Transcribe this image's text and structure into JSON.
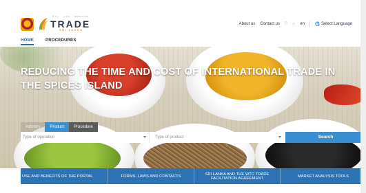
{
  "header": {
    "logo_top": "සිංහල · தமிழ் · ENGLISH",
    "logo_text": "TRADE",
    "logo_sub": "SRI LANKA",
    "links": [
      {
        "label": "About us"
      },
      {
        "label": "Contact us"
      }
    ],
    "languages": [
      "සි",
      "த",
      "en"
    ],
    "translate_label": "Select Language"
  },
  "nav": {
    "items": [
      {
        "label": "HOME"
      },
      {
        "label": "PROCEDURES"
      }
    ]
  },
  "hero": {
    "title": "REDUCING THE TIME AND COST OF INTERNATIONAL TRADE IN THE SPICES ISLAND"
  },
  "search": {
    "tabs": [
      "Industry",
      "Product",
      "Procedure"
    ],
    "operation_placeholder": "Type of operation",
    "product_placeholder": "Type of product",
    "button_label": "Search"
  },
  "tiles": [
    {
      "label": "USE AND BENEFITS OF THE PORTAL"
    },
    {
      "label": "FORMS, LAWS AND CONTACTS"
    },
    {
      "label": "SRI LANKA AND THE WTO TRADE FACILITATION AGREEMENT"
    },
    {
      "label": "MARKET ANALYSIS TOOLS"
    }
  ],
  "colors": {
    "accent": "#3a8fd0",
    "tile_bar": "#2c73b3",
    "logo_orange": "#c76b19"
  }
}
